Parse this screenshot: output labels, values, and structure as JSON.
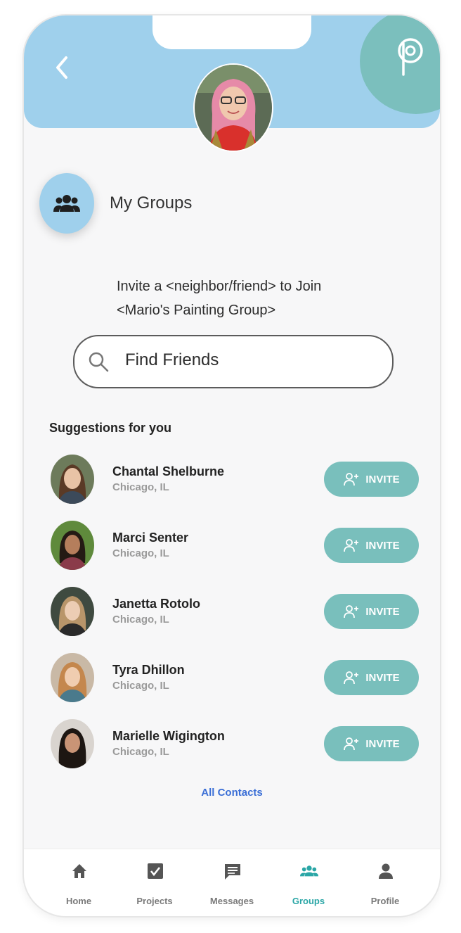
{
  "header": {
    "back_icon": "chevron-left-icon",
    "logo_icon": "p-logo-icon",
    "accent_color": "#9fd0ec",
    "corner_color": "#7bbfbd"
  },
  "groups": {
    "icon": "groups-icon",
    "label": "My Groups"
  },
  "invite": {
    "line1": "Invite a <neighbor/friend> to Join",
    "line2": "<Mario's Painting Group>"
  },
  "search": {
    "icon": "search-icon",
    "placeholder": "Find Friends"
  },
  "suggestions": {
    "title": "Suggestions for you",
    "items": [
      {
        "name": "Chantal Shelburne",
        "location": "Chicago, IL",
        "button": "INVITE"
      },
      {
        "name": "Marci Senter",
        "location": "Chicago, IL",
        "button": "INVITE"
      },
      {
        "name": "Janetta Rotolo",
        "location": "Chicago, IL",
        "button": "INVITE"
      },
      {
        "name": "Tyra Dhillon",
        "location": "Chicago, IL",
        "button": "INVITE"
      },
      {
        "name": "Marielle Wigington",
        "location": "Chicago, IL",
        "button": "INVITE"
      }
    ],
    "button_color": "#79bfbc"
  },
  "all_contacts": "All Contacts",
  "nav": {
    "items": [
      {
        "label": "Home",
        "icon": "home-icon"
      },
      {
        "label": "Projects",
        "icon": "checkbox-icon"
      },
      {
        "label": "Messages",
        "icon": "message-icon"
      },
      {
        "label": "Groups",
        "icon": "groups-icon",
        "active": true
      },
      {
        "label": "Profile",
        "icon": "person-icon"
      }
    ],
    "active_color": "#2aa6a6"
  }
}
